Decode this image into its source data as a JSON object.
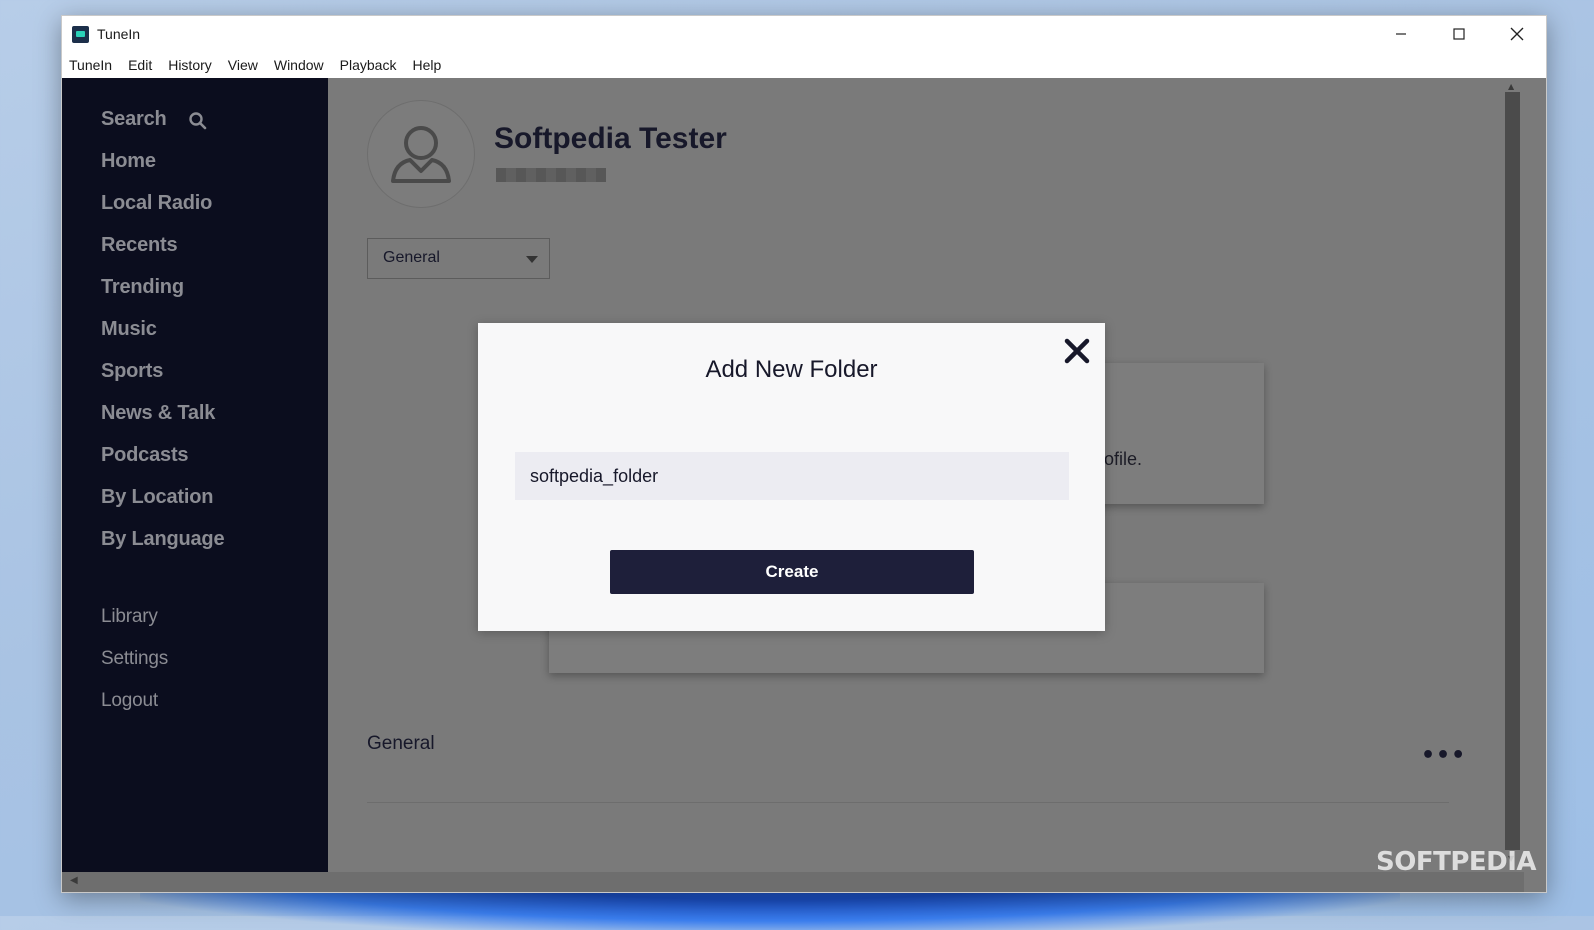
{
  "window": {
    "title": "TuneIn",
    "controls": [
      "minimize",
      "maximize",
      "close"
    ]
  },
  "menubar": {
    "items": [
      "TuneIn",
      "Edit",
      "History",
      "View",
      "Window",
      "Playback",
      "Help"
    ]
  },
  "sidebar": {
    "primary": [
      "Search",
      "Home",
      "Local Radio",
      "Recents",
      "Trending",
      "Music",
      "Sports",
      "News & Talk",
      "Podcasts",
      "By Location",
      "By Language"
    ],
    "secondary": [
      "Library",
      "Settings",
      "Logout"
    ]
  },
  "profile": {
    "name": "Softpedia Tester"
  },
  "filter": {
    "selected": "General"
  },
  "background_card": {
    "partial_text": "ofile."
  },
  "section": {
    "label": "General",
    "more": "•••"
  },
  "modal": {
    "title": "Add New Folder",
    "input_value": "softpedia_folder",
    "button_label": "Create"
  },
  "watermark": "SOFTPEDIA",
  "colors": {
    "sidebar_bg": "#0b0d1e",
    "overlay_gray": "#7a7a7a",
    "primary_button": "#1e1f3a",
    "modal_bg": "#f8f8f9"
  }
}
